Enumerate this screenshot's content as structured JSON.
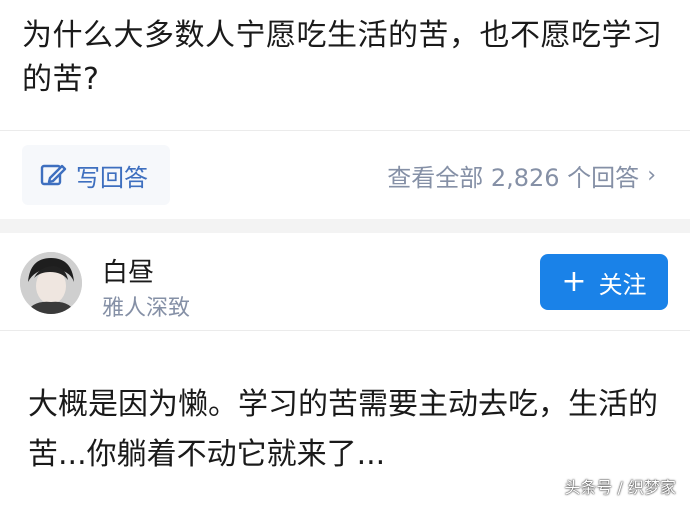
{
  "question": {
    "title": "为什么大多数人宁愿吃生活的苦，也不愿吃学习的苦?"
  },
  "actions": {
    "write_answer_label": "写回答",
    "view_all_label": "查看全部 2,826 个回答",
    "view_all_chevron": "›"
  },
  "answer": {
    "author": {
      "name": "白昼",
      "bio": "雅人深致"
    },
    "follow": {
      "icon": "+",
      "label": "关注"
    },
    "content": "大概是因为懒。学习的苦需要主动去吃，生活的苦...你躺着不动它就来了..."
  },
  "watermark": "头条号 / 织梦家",
  "colors": {
    "accent_blue": "#1a82e8",
    "link_blue": "#3e6fbf",
    "muted_gray": "#8590a6",
    "band_gray": "#f3f3f3"
  }
}
